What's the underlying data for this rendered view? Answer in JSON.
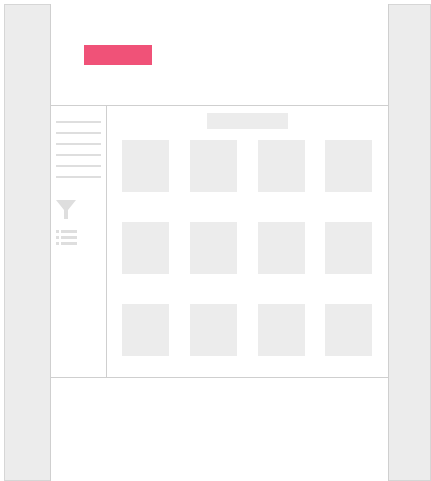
{
  "colors": {
    "accent": "#f05278",
    "placeholder": "#ececec",
    "border": "#cfcfcf",
    "outer_background": "#ececec"
  },
  "header": {
    "logo": {
      "icon": "logo-placeholder",
      "text": ""
    }
  },
  "sidebar": {
    "menu_lines": 6,
    "filter_icon": "filter-icon",
    "list_icon": "list-icon"
  },
  "main": {
    "title": "",
    "grid": {
      "rows": 3,
      "columns": 4
    }
  },
  "footer": {
    "text": ""
  }
}
